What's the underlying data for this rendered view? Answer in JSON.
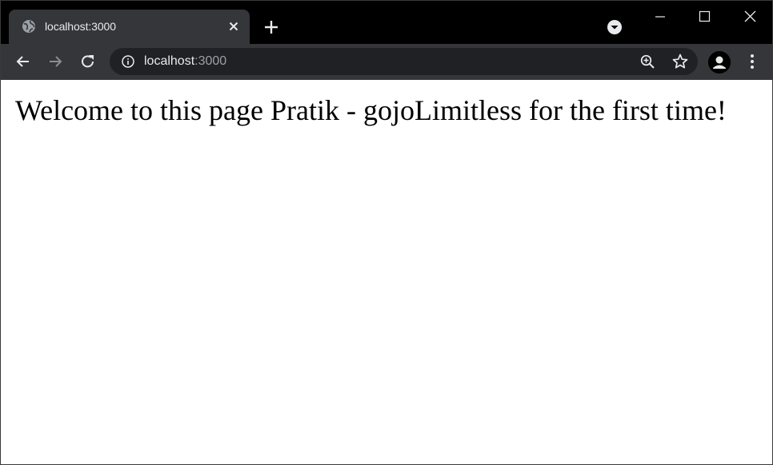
{
  "browser": {
    "tab": {
      "title": "localhost:3000",
      "favicon": "globe-icon",
      "close_icon": "close-icon"
    },
    "new_tab_icon": "plus-icon",
    "tab_search_icon": "chevron-down-circle-icon",
    "window_controls": [
      "minimize-icon",
      "maximize-icon",
      "close-icon"
    ],
    "toolbar": {
      "back_icon": "arrow-left-icon",
      "forward_icon": "arrow-right-icon",
      "reload_icon": "reload-icon",
      "address": {
        "host": "localhost",
        "port": ":3000",
        "security_icon": "info-icon"
      },
      "zoom_icon": "zoom-in-icon",
      "bookmark_icon": "star-icon",
      "profile_icon": "avatar-icon",
      "menu_icon": "kebab-menu-icon"
    },
    "colors": {
      "tabstrip": "#000000",
      "active_tab": "#35363a",
      "toolbar": "#35363a",
      "omnibox": "#202124",
      "text": "#e8eaed",
      "muted_text": "#9aa0a6"
    }
  },
  "page": {
    "heading": "Welcome to this page Pratik - gojoLimitless for the first time!"
  }
}
